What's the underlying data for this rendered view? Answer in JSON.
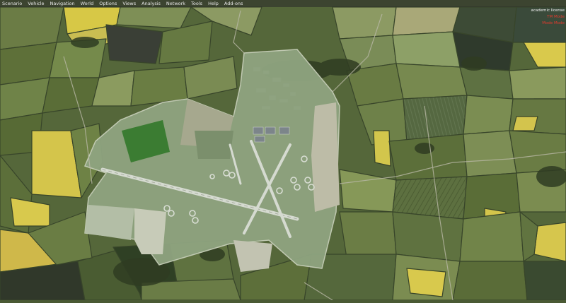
{
  "menu": [
    {
      "label": "Scenario"
    },
    {
      "label": "Vehicle"
    },
    {
      "label": "Navigation"
    },
    {
      "label": "World"
    },
    {
      "label": "Options"
    },
    {
      "label": "Views"
    },
    {
      "label": "Analysis"
    },
    {
      "label": "Network"
    },
    {
      "label": "Tools"
    },
    {
      "label": "Help"
    },
    {
      "label": "Add-ons"
    }
  ],
  "hud": {
    "line1": "academic license",
    "line2": "TM Mode",
    "line3": "Mode Mode"
  },
  "colors": {
    "field_dark": "#3f5129",
    "field_mid": "#6b7c45",
    "field_light": "#8c9a63",
    "rapeseed": "#d7c846",
    "airfield_grass": "#8fa480",
    "runway": "#c8cfc5",
    "hud_red": "#e43b2e"
  }
}
